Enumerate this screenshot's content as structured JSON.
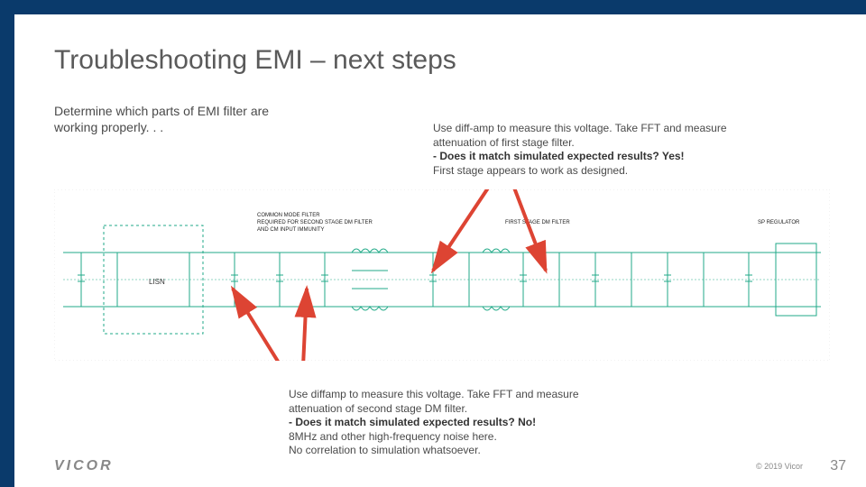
{
  "title": "Troubleshooting EMI – next steps",
  "intro": "Determine which parts of EMI filter are working properly. . .",
  "note_top_1": "Use diff-amp to measure this voltage. Take FFT and measure attenuation of first stage filter.",
  "note_top_2": "- Does it match simulated expected results? Yes!",
  "note_top_3": "First stage appears to work as designed.",
  "note_bot_1": "Use diffamp to measure this voltage. Take FFT and measure attenuation of second stage DM filter.",
  "note_bot_2": "- Does it match simulated expected results? No!",
  "note_bot_3": "8MHz and other high-frequency noise here.",
  "note_bot_4": "No correlation to simulation whatsoever.",
  "schem_label_1": "COMMON MODE FILTER",
  "schem_label_2": "REQUIRED FOR SECOND STAGE DM FILTER",
  "schem_label_3": "AND CM INPUT IMMUNITY",
  "schem_label_4": "FIRST STAGE DM FILTER",
  "schem_label_5": "SP REGULATOR",
  "schem_label_6": "LISN",
  "logo": "VICOR",
  "copyright": "© 2019 Vicor",
  "page": "37"
}
